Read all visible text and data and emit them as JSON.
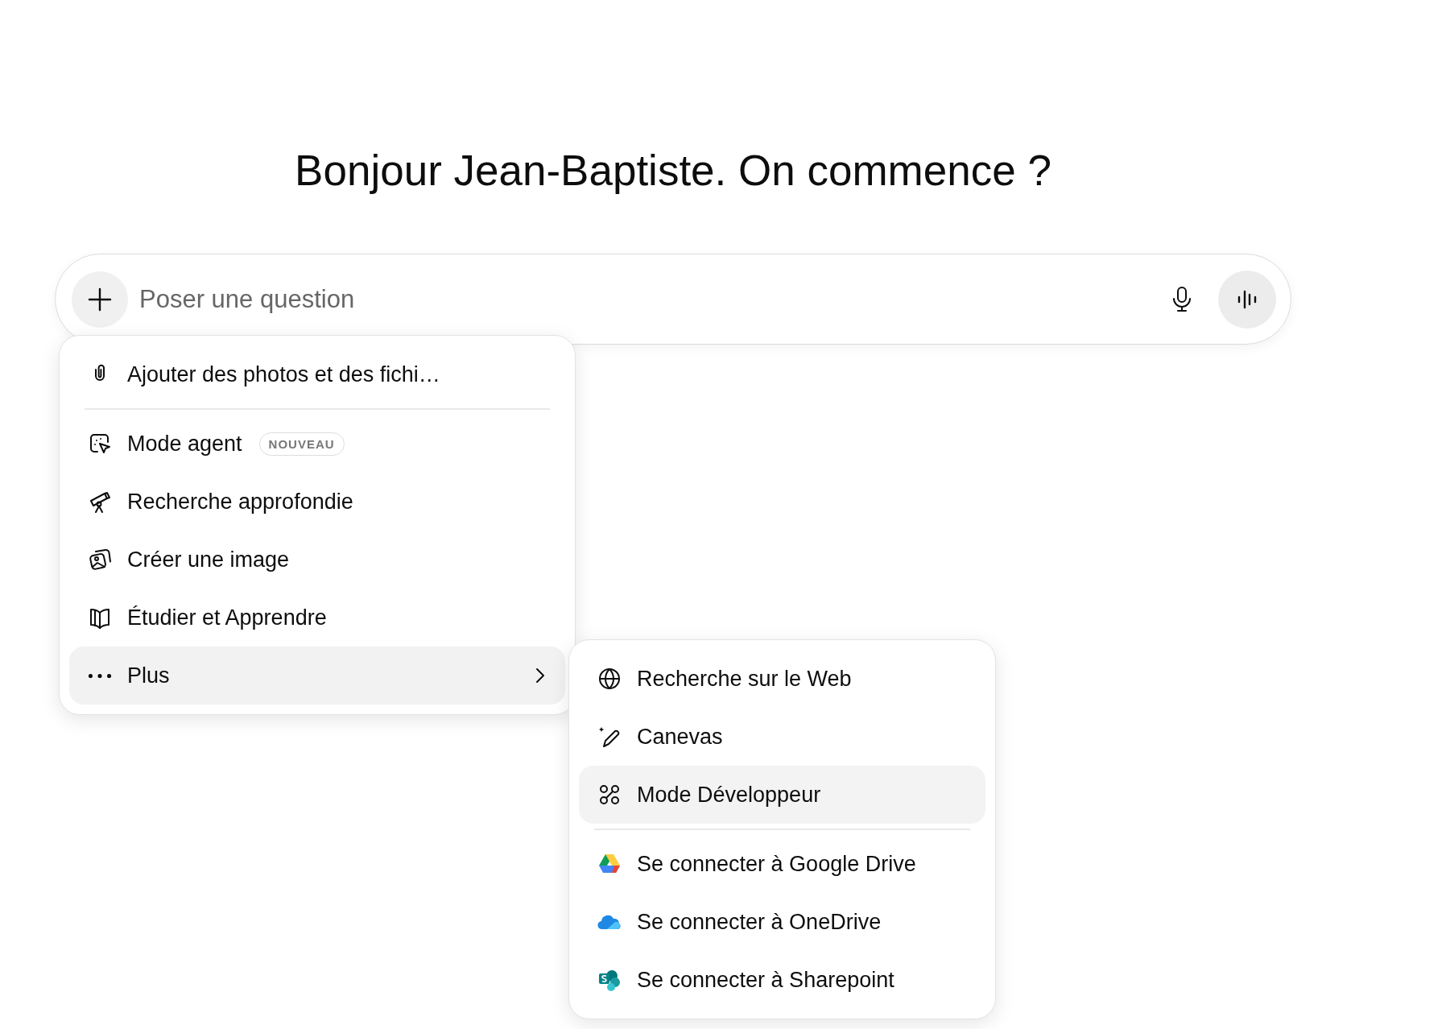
{
  "greeting": "Bonjour Jean-Baptiste. On commence ?",
  "composer": {
    "placeholder": "Poser une question"
  },
  "menu": {
    "items": [
      {
        "kind": "item",
        "label": "Ajouter des photos et des fichi…",
        "selected": false
      },
      {
        "kind": "divider"
      },
      {
        "kind": "item",
        "label": "Mode agent",
        "badge": "NOUVEAU",
        "selected": false
      },
      {
        "kind": "item",
        "label": "Recherche approfondie",
        "selected": false
      },
      {
        "kind": "item",
        "label": "Créer une image",
        "selected": false
      },
      {
        "kind": "item",
        "label": "Étudier et Apprendre",
        "selected": false
      },
      {
        "kind": "submenu",
        "label": "Plus",
        "expanded": true
      }
    ]
  },
  "submenu": {
    "items": [
      {
        "kind": "item",
        "label": "Recherche sur le Web",
        "selected": false
      },
      {
        "kind": "item",
        "label": "Canevas",
        "selected": false
      },
      {
        "kind": "item",
        "label": "Mode Développeur",
        "selected": true
      },
      {
        "kind": "divider"
      },
      {
        "kind": "item",
        "label": "Se connecter à Google Drive",
        "selected": false
      },
      {
        "kind": "item",
        "label": "Se connecter à OneDrive",
        "selected": false
      },
      {
        "kind": "item",
        "label": "Se connecter à Sharepoint",
        "selected": false
      }
    ]
  }
}
